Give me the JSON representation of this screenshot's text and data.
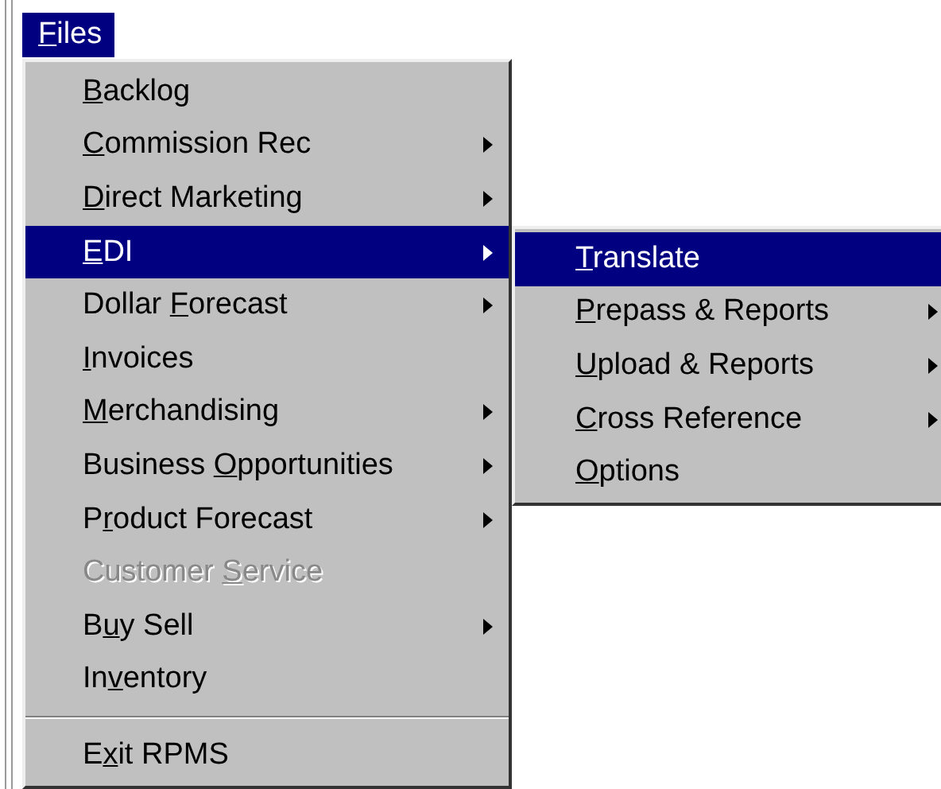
{
  "menu_bar": {
    "title": {
      "access_key": "F",
      "label_after": "iles"
    },
    "selected": true
  },
  "menu": {
    "items": [
      {
        "kind": "item",
        "access_key": "B",
        "label_after": "acklog",
        "submenu": false,
        "disabled": false,
        "selected": false
      },
      {
        "kind": "item",
        "access_key": "C",
        "label_after": "ommission Rec",
        "submenu": true,
        "disabled": false,
        "selected": false
      },
      {
        "kind": "item",
        "access_key": "D",
        "label_after": "irect Marketing",
        "submenu": true,
        "disabled": false,
        "selected": false
      },
      {
        "kind": "item",
        "access_key": "E",
        "label_after": "DI",
        "submenu": true,
        "disabled": false,
        "selected": true
      },
      {
        "kind": "item",
        "label_before": "Dollar ",
        "access_key": "F",
        "label_after": "orecast",
        "submenu": true,
        "disabled": false,
        "selected": false
      },
      {
        "kind": "item",
        "access_key": "I",
        "label_after": "nvoices",
        "submenu": false,
        "disabled": false,
        "selected": false
      },
      {
        "kind": "item",
        "access_key": "M",
        "label_after": "erchandising",
        "submenu": true,
        "disabled": false,
        "selected": false
      },
      {
        "kind": "item",
        "label_before": "Business ",
        "access_key": "O",
        "label_after": "pportunities",
        "submenu": true,
        "disabled": false,
        "selected": false
      },
      {
        "kind": "item",
        "label_before": "P",
        "access_key": "r",
        "label_after": "oduct Forecast",
        "submenu": true,
        "disabled": false,
        "selected": false
      },
      {
        "kind": "item",
        "label_before": "Customer ",
        "access_key": "S",
        "label_after": "ervice",
        "submenu": false,
        "disabled": true,
        "selected": false
      },
      {
        "kind": "item",
        "label_before": "B",
        "access_key": "u",
        "label_after": "y Sell",
        "submenu": true,
        "disabled": false,
        "selected": false
      },
      {
        "kind": "item",
        "label_before": "In",
        "access_key": "v",
        "label_after": "entory",
        "submenu": false,
        "disabled": false,
        "selected": false
      },
      {
        "kind": "separator"
      },
      {
        "kind": "item",
        "label_before": "E",
        "access_key": "x",
        "label_after": "it RPMS",
        "submenu": false,
        "disabled": false,
        "selected": false
      }
    ]
  },
  "submenu": {
    "items": [
      {
        "kind": "item",
        "access_key": "T",
        "label_after": "ranslate",
        "submenu": false,
        "disabled": false,
        "selected": true
      },
      {
        "kind": "item",
        "access_key": "P",
        "label_after": "repass & Reports",
        "submenu": true,
        "disabled": false,
        "selected": false
      },
      {
        "kind": "item",
        "access_key": "U",
        "label_after": "pload & Reports",
        "submenu": true,
        "disabled": false,
        "selected": false
      },
      {
        "kind": "item",
        "access_key": "C",
        "label_after": "ross Reference",
        "submenu": true,
        "disabled": false,
        "selected": false
      },
      {
        "kind": "item",
        "access_key": "O",
        "label_after": "ptions",
        "submenu": false,
        "disabled": false,
        "selected": false
      }
    ]
  }
}
